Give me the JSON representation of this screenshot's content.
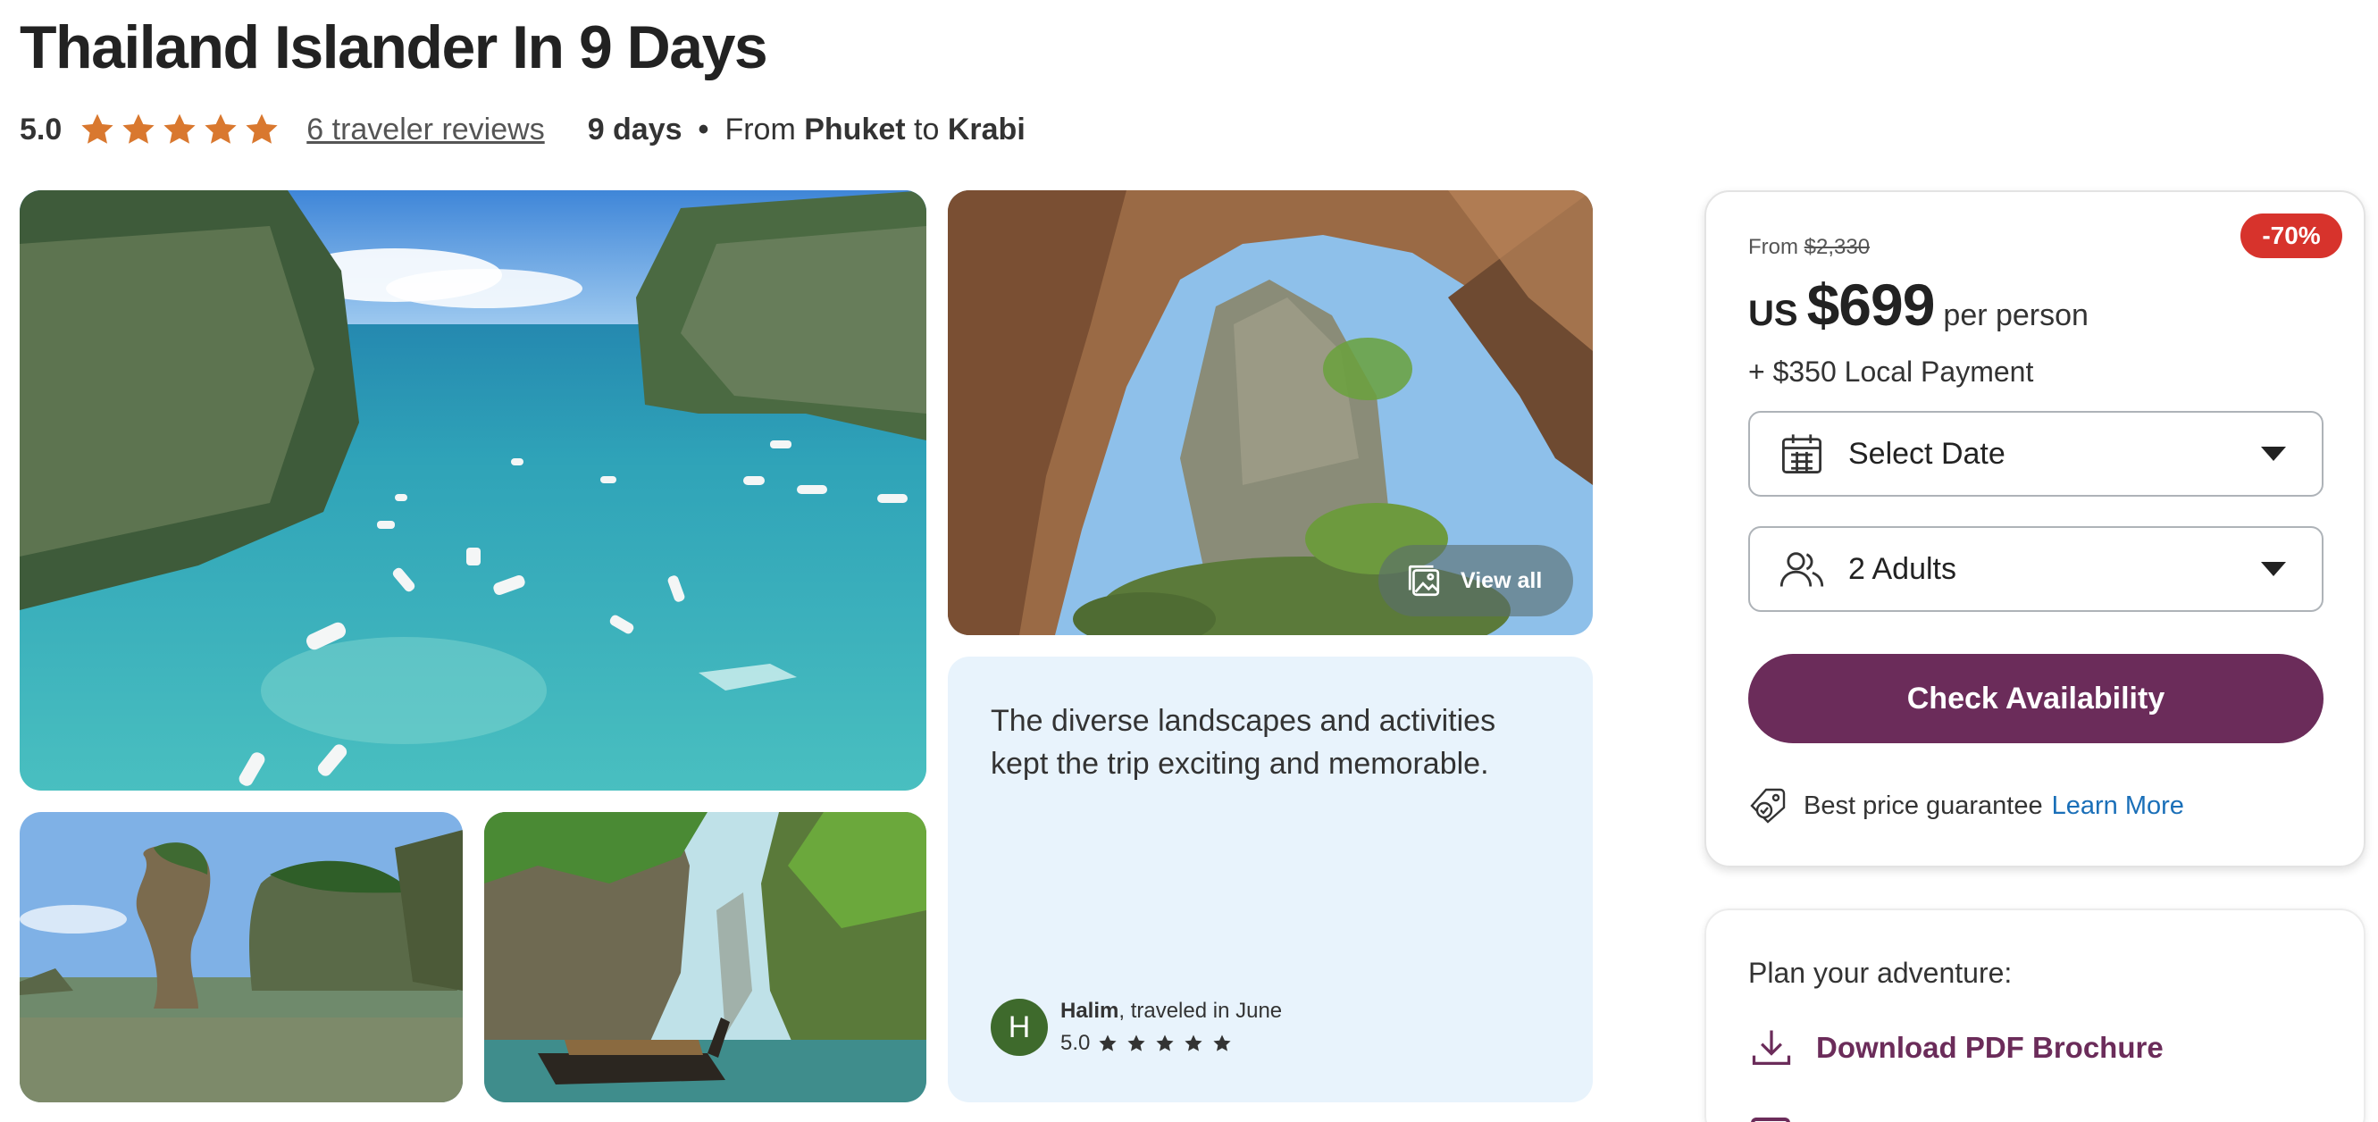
{
  "tour": {
    "title": "Thailand Islander In 9 Days",
    "rating": "5.0",
    "stars": 5,
    "reviews_link": "6 traveler reviews",
    "duration": "9 days",
    "separator": "•",
    "from_word": "From",
    "start": "Phuket",
    "to_word": "to",
    "end": "Krabi"
  },
  "gallery": {
    "view_all_label": "View all",
    "view_all_icon": "gallery-icon"
  },
  "review": {
    "text": "The diverse landscapes and activities kept the trip exciting and memorable.",
    "avatar_initial": "H",
    "reviewer_name": "Halim",
    "reviewer_suffix": ", traveled in June",
    "rating": "5.0",
    "stars": 5
  },
  "booking": {
    "discount": "-70%",
    "from_label": "From",
    "original_price": "$2,330",
    "currency": "US",
    "price": "$699",
    "per": "per person",
    "local_payment": "+ $350 Local Payment",
    "date_select": "Select Date",
    "travelers_select": "2 Adults",
    "cta": "Check Availability",
    "guarantee": "Best price guarantee",
    "learn_more": "Learn More"
  },
  "plan": {
    "title": "Plan your adventure:",
    "download": "Download PDF Brochure"
  },
  "colors": {
    "star": "#d9782f",
    "brand": "#6b2c5a",
    "discount": "#d7332c",
    "link": "#1a6fb8",
    "review_bg": "#e8f3fc",
    "avatar": "#3e6a2c"
  }
}
